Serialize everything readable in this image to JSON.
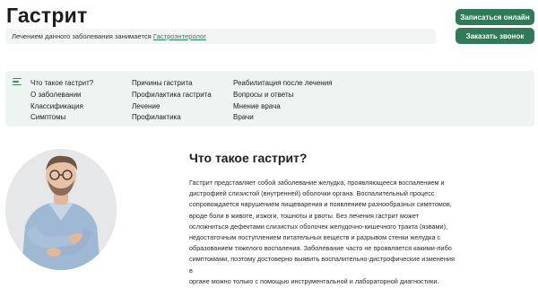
{
  "header": {
    "title": "Гастрит",
    "doctor_prefix": "Лечением данного заболевания занимается",
    "doctor_link": "Гастроэнтеролог"
  },
  "actions": {
    "online_label": "Записаться онлайн",
    "call_label": "Заказать звонок"
  },
  "toc": {
    "columns": [
      [
        "Что такое гастрит?",
        "О заболевании",
        "Классификация",
        "Симптомы"
      ],
      [
        "Причины гастрита",
        "Профилактика гастрита",
        "Лечение",
        "Профилактика"
      ],
      [
        "Реабилитация после лечения",
        "Вопросы и ответы",
        "Мнение врача",
        "Врачи"
      ]
    ]
  },
  "section": {
    "title": "Что такое гастрит?",
    "lines": [
      "Гастрит представляет собой заболевание желудка, проявляющееся воспалением и",
      "дистрофией слизистой (внутренней) оболочки органа. Воспалительный процесс",
      "сопровождается нарушением пищеварения и появлением разнообразных симптомов,",
      "вроде боли в животе, изжоги, тошноты и рвоты. Без лечения гастрит может",
      "осложниться дефектами слизистых оболочек желудочно-кишечного тракта (язвами),",
      "недостаточным поступлением питательных веществ и разрывом стенки желудка с",
      "образованием тяжелого воспаления. Заболевание часто не проявляется какими-либо",
      "симптомами, поэтому достоверно выявить воспалительно-дистрофические изменения в",
      "органе можно только с помощью инструментальной и лабораторной диагностики."
    ]
  },
  "colors": {
    "accent": "#2f7a57",
    "toc_bg": "#eef4f1",
    "link": "#2e7d5b"
  }
}
